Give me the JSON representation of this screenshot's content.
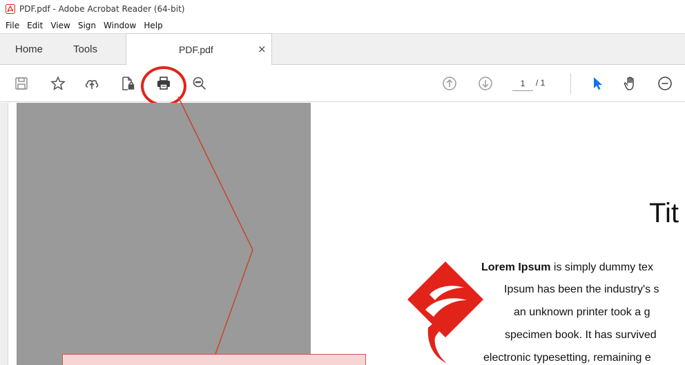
{
  "window": {
    "title": "PDF.pdf - Adobe Acrobat Reader (64-bit)"
  },
  "menu": {
    "items": [
      "File",
      "Edit",
      "View",
      "Sign",
      "Window",
      "Help"
    ]
  },
  "tabs": {
    "home": "Home",
    "tools": "Tools",
    "document": "PDF.pdf",
    "close_glyph": "×"
  },
  "toolbar": {
    "icons": [
      "save-icon",
      "bookmark-star-icon",
      "upload-cloud-icon",
      "protect-file-icon",
      "print-icon",
      "zoom-search-icon",
      "page-up-icon",
      "page-down-icon",
      "select-cursor-icon",
      "hand-tool-icon",
      "zoom-out-icon"
    ],
    "current_page": "1",
    "page_total": "/ 1"
  },
  "document": {
    "title": "Tit",
    "lines": [
      {
        "bold": "Lorem Ipsum",
        "text": " is simply dummy tex"
      },
      {
        "bold": "",
        "text": "Ipsum has been the industry's s"
      },
      {
        "bold": "",
        "text": "an unknown printer took a g"
      },
      {
        "bold": "",
        "text": "specimen book. It has survived"
      },
      {
        "bold": "",
        "text": "electronic typesetting, remaining e"
      }
    ]
  },
  "colors": {
    "accent_red": "#e2231a",
    "select_blue": "#1473e6",
    "toolbar_icon": "#505050"
  }
}
